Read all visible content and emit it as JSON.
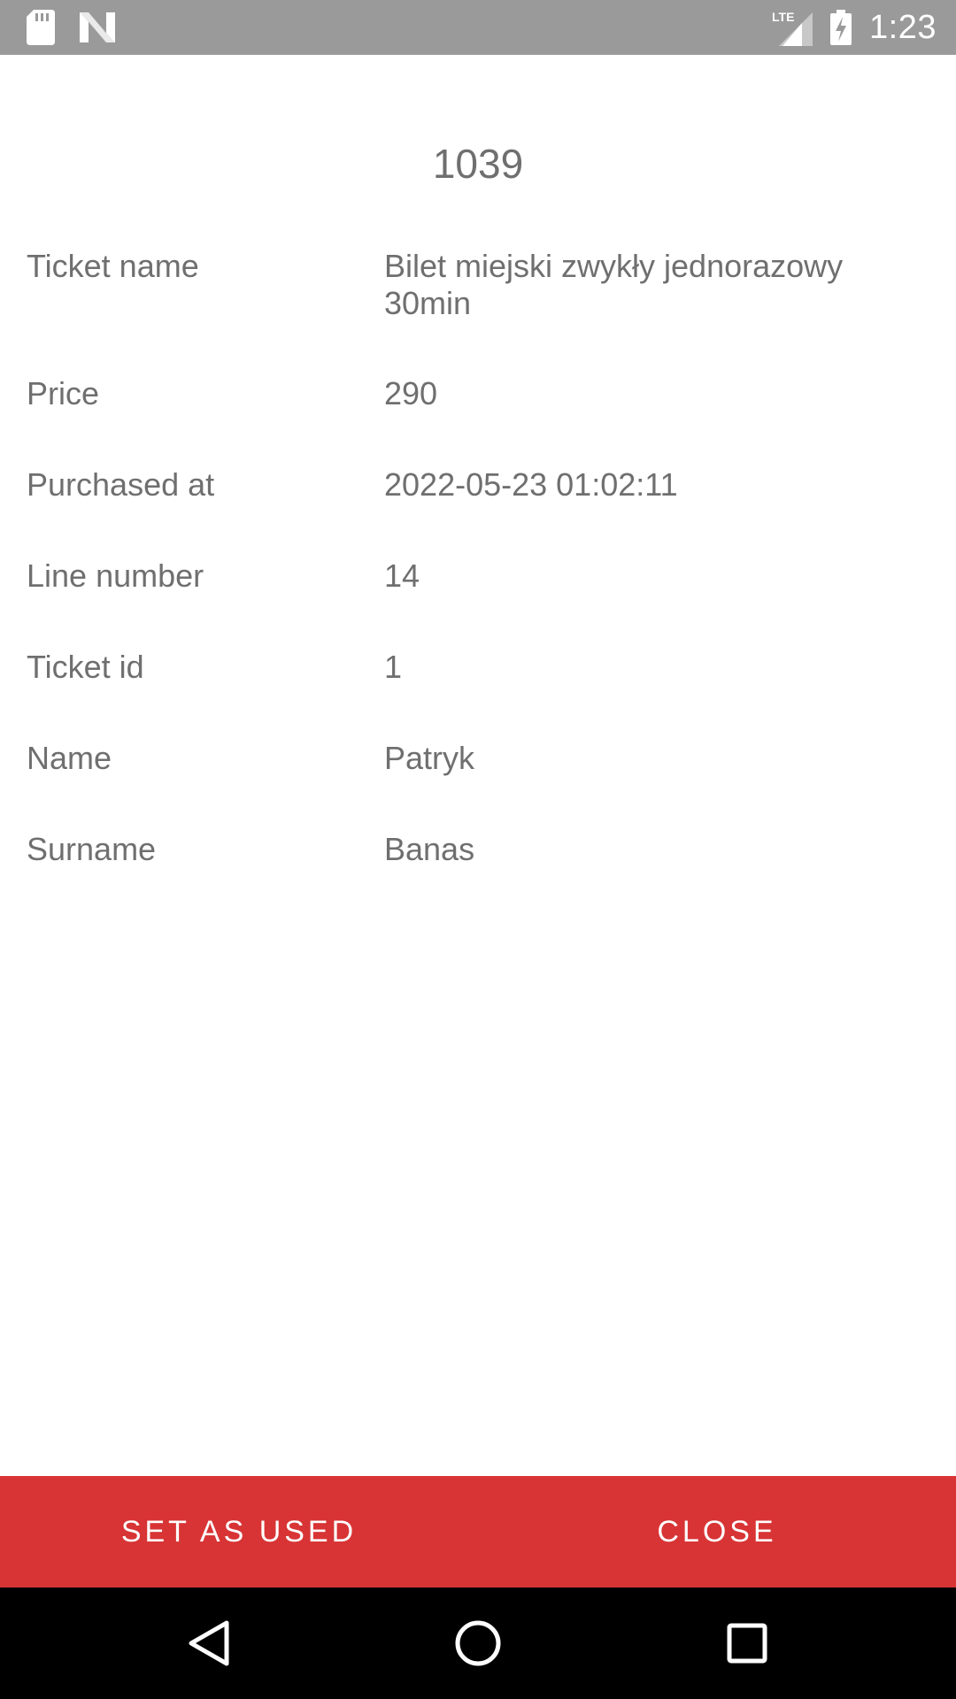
{
  "status_bar": {
    "time": "1:23",
    "network_label": "LTE",
    "icons": [
      "sd-card-icon",
      "n-logo-icon",
      "signal-icon",
      "battery-charging-icon"
    ]
  },
  "ticket": {
    "title": "1039",
    "fields": [
      {
        "label": "Ticket name",
        "value": "Bilet miejski zwykły jednorazowy 30min"
      },
      {
        "label": "Price",
        "value": "290"
      },
      {
        "label": "Purchased at",
        "value": "2022-05-23 01:02:11"
      },
      {
        "label": "Line number",
        "value": "14"
      },
      {
        "label": "Ticket id",
        "value": "1"
      },
      {
        "label": "Name",
        "value": "Patryk"
      },
      {
        "label": "Surname",
        "value": "Banas"
      }
    ]
  },
  "actions": {
    "set_as_used_label": "SET AS USED",
    "close_label": "CLOSE"
  },
  "navigation": {
    "icons": [
      "back-icon",
      "home-icon",
      "recents-icon"
    ]
  },
  "colors": {
    "status_bar": "#9a9a9a",
    "action_bar": "#d83435",
    "text": "#6f6f6f",
    "nav_bar": "#000000"
  }
}
